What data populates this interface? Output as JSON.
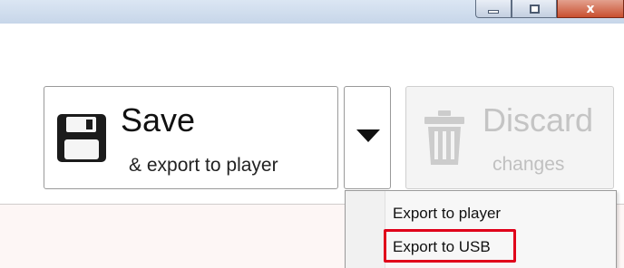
{
  "window": {
    "controls": {
      "minimize_icon": "minimize-icon",
      "maximize_icon": "maximize-icon",
      "close_label": "x"
    }
  },
  "toolbar": {
    "save": {
      "title": "Save",
      "subtitle": "& export to player",
      "icon": "floppy-disk-icon"
    },
    "dropdown": {
      "icon": "triangle-down-icon"
    },
    "discard": {
      "title": "Discard",
      "subtitle": "changes",
      "icon": "trash-icon",
      "enabled": false
    }
  },
  "menu": {
    "items": [
      {
        "label": "Export to player"
      },
      {
        "label": "Export to USB",
        "highlighted": true
      }
    ],
    "highlight_color": "#e0001a"
  }
}
